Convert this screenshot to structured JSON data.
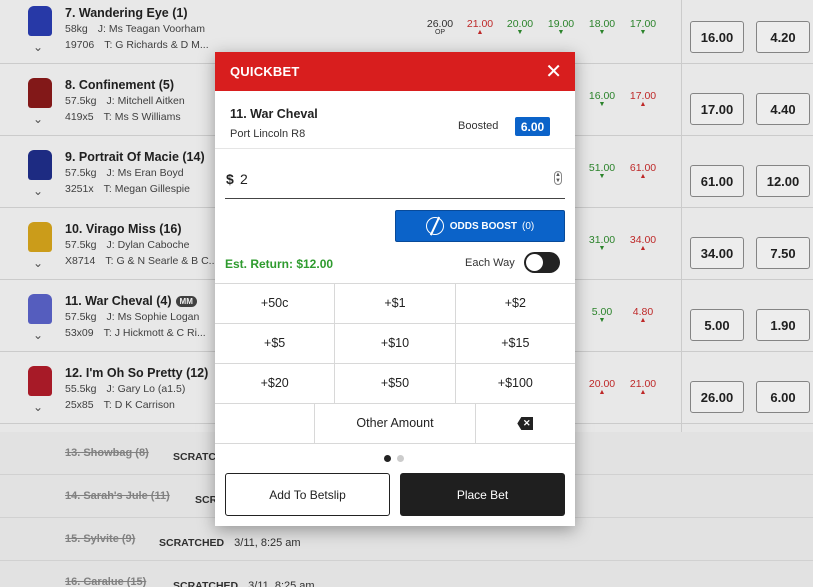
{
  "runners": [
    {
      "name": "7. Wandering Eye (1)",
      "weight": "58kg",
      "jockey": "J: Ms Teagan Voorham",
      "form": "19706",
      "trainer": "T: G Richards & D M...",
      "silk": "#2a3db0",
      "op": "26.00",
      "op_label": "OP",
      "flucs": [
        [
          "21.00",
          "up"
        ],
        [
          "20.00",
          "down"
        ],
        [
          "19.00",
          "down"
        ],
        [
          "18.00",
          "down"
        ],
        [
          "17.00",
          "down"
        ]
      ],
      "win": "16.00",
      "place": "4.20",
      "mm": ""
    },
    {
      "name": "8. Confinement (5)",
      "weight": "57.5kg",
      "jockey": "J: Mitchell Aitken",
      "form": "419x5",
      "trainer": "T: Ms S Williams",
      "silk": "#8a1a1a",
      "op": "",
      "op_label": "",
      "flucs": [
        [
          "16.00",
          "down"
        ],
        [
          "17.00",
          "up"
        ]
      ],
      "win": "17.00",
      "place": "4.40",
      "mm": ""
    },
    {
      "name": "9. Portrait Of Macie (14)",
      "weight": "57.5kg",
      "jockey": "J: Ms Eran Boyd",
      "form": "3251x",
      "trainer": "T: Megan Gillespie",
      "silk": "#1f2e8a",
      "op": "",
      "op_label": "",
      "flucs": [
        [
          "51.00",
          "down"
        ],
        [
          "61.00",
          "up"
        ]
      ],
      "win": "61.00",
      "place": "12.00",
      "mm": ""
    },
    {
      "name": "10. Virago Miss (16)",
      "weight": "57.5kg",
      "jockey": "J: Dylan Caboche",
      "form": "X8714",
      "trainer": "T: G & N Searle & B C...",
      "silk": "#d6a51c",
      "op": "",
      "op_label": "",
      "flucs": [
        [
          "31.00",
          "down"
        ],
        [
          "34.00",
          "up"
        ]
      ],
      "win": "34.00",
      "place": "7.50",
      "mm": ""
    },
    {
      "name": "11. War Cheval (4)",
      "weight": "57.5kg",
      "jockey": "J: Ms Sophie Logan",
      "form": "53x09",
      "trainer": "T: J Hickmott & C Ri...",
      "silk": "#5a62c9",
      "op": "",
      "op_label": "",
      "flucs": [
        [
          "5.00",
          "down"
        ],
        [
          "4.80",
          "up"
        ]
      ],
      "win": "5.00",
      "place": "1.90",
      "mm": "MM"
    },
    {
      "name": "12. I'm Oh So Pretty (12)",
      "weight": "55.5kg",
      "jockey": "J: Gary Lo (a1.5)",
      "form": "25x85",
      "trainer": "T: D K Carrison",
      "silk": "#b01c2a",
      "op": "",
      "op_label": "",
      "flucs": [
        [
          "20.00",
          "up"
        ],
        [
          "21.00",
          "up"
        ]
      ],
      "win": "26.00",
      "place": "6.00",
      "mm": ""
    }
  ],
  "scratched": [
    {
      "name": "13. Showbag (8)",
      "tag": "SCRATCH",
      "time": ""
    },
    {
      "name": "14. Sarah's Jule (11)",
      "tag": "SCRA",
      "time": ""
    },
    {
      "name": "15. Sylvite (9)",
      "tag": "SCRATCHED",
      "time": "3/11, 8:25 am"
    },
    {
      "name": "16. Caralue (15)",
      "tag": "SCRATCHED",
      "time": "3/11, 8:25 am"
    }
  ],
  "quickbet": {
    "title": "QUICKBET",
    "close_icon": "close-icon",
    "runner": "11. War Cheval",
    "meeting": "Port Lincoln R8",
    "boosted_label": "Boosted",
    "boosted_odds": "6.00",
    "currency": "$",
    "stake": "2",
    "odds_boost_label": "ODDS BOOST",
    "odds_boost_count": "(0)",
    "est_return": "Est. Return: $12.00",
    "each_way_label": "Each Way",
    "each_way_on": false,
    "keypad": [
      [
        "+50c",
        "+$1",
        "+$2"
      ],
      [
        "+$5",
        "+$10",
        "+$15"
      ],
      [
        "+$20",
        "+$50",
        "+$100"
      ],
      [
        "",
        "Other Amount",
        "backspace-icon"
      ]
    ],
    "add_betslip_label": "Add To Betslip",
    "place_bet_label": "Place Bet",
    "page_indicator": {
      "pages": 2,
      "current": 1
    }
  }
}
